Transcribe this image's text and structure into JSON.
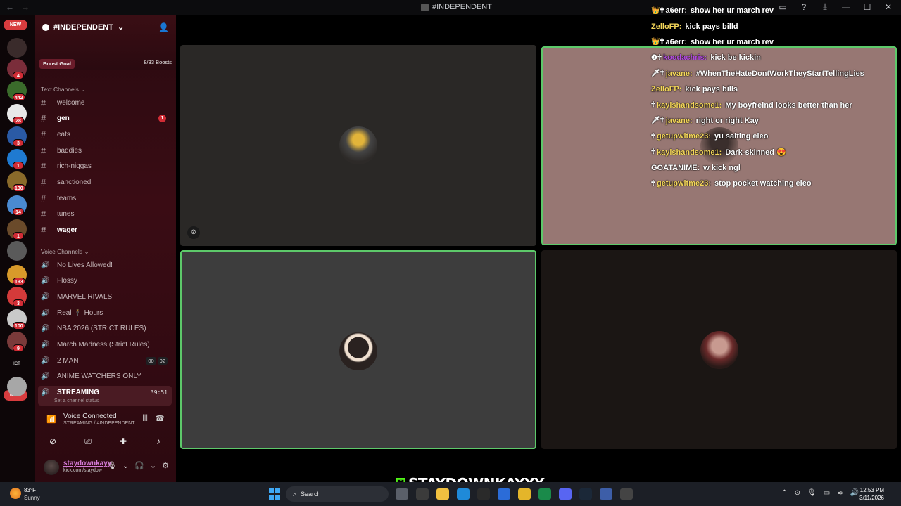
{
  "window": {
    "title": "#INDEPENDENT"
  },
  "guilds": {
    "new_top": "NEW",
    "new_bottom": "NEW",
    "badges": [
      "4",
      "442",
      "28",
      "3",
      "1",
      "130",
      "14",
      "1",
      "193",
      "3",
      "100",
      "9"
    ],
    "colors": [
      "#3a2b2b",
      "#7a2d3a",
      "#3a6b2b",
      "#e8e8e8",
      "#2a5aa5",
      "#1f7ad1",
      "#8a6a2a",
      "#4a8ad1",
      "#6a4a2a",
      "#5a5a5a",
      "#d89a2a",
      "#d43a3a",
      "#c9c9c9",
      "#7a3a3a",
      "#1a1a1a",
      "#a7a7a7"
    ],
    "ict_label": "ICT"
  },
  "server": {
    "name": "#INDEPENDENT",
    "boost_goal": "Boost Goal",
    "boost_count": "8/33 Boosts"
  },
  "text_channels": {
    "header": "Text Channels",
    "items": [
      {
        "name": "welcome"
      },
      {
        "name": "gen",
        "unread": "1"
      },
      {
        "name": "eats"
      },
      {
        "name": "baddies"
      },
      {
        "name": "rich-niggas"
      },
      {
        "name": "sanctioned"
      },
      {
        "name": "teams"
      },
      {
        "name": "tunes"
      },
      {
        "name": "wager"
      }
    ]
  },
  "voice_channels": {
    "header": "Voice Channels",
    "items": [
      {
        "name": "No Lives Allowed!"
      },
      {
        "name": "Flossy"
      },
      {
        "name": "MARVEL RIVALS"
      },
      {
        "name": "Real 🕴 Hours"
      },
      {
        "name": "NBA 2026 (STRICT RULES)"
      },
      {
        "name": "March Madness (Strict Rules)"
      },
      {
        "name": "2 MAN",
        "tag_a": "00",
        "tag_b": "02"
      },
      {
        "name": "ANIME WATCHERS ONLY"
      },
      {
        "name": "STREAMING",
        "timer": "39:51",
        "status": "Set a channel status"
      }
    ]
  },
  "voice": {
    "title": "Voice Connected",
    "subtitle": "STREAMING / #INDEPENDENT"
  },
  "user": {
    "name": "staydownkayy",
    "status": "kick.com/staydow"
  },
  "chat": [
    {
      "badge": "👑🕆",
      "user": "a6err:",
      "color": "#ffffff",
      "text": "show her ur march rev"
    },
    {
      "badge": "",
      "user": "ZelloFP:",
      "color": "#f5d75a",
      "text": "kick pays billd"
    },
    {
      "badge": "👑🕆",
      "user": "a6err:",
      "color": "#ffffff",
      "text": "show her ur march rev"
    },
    {
      "badge": "❶🕆",
      "user": "koodachris:",
      "color": "#b24be0",
      "text": "kick be kickin"
    },
    {
      "badge": "🗡🕆",
      "user": "javane:",
      "color": "#f5d75a",
      "text": "#WhenTheHateDontWorkTheyStartTellingLies"
    },
    {
      "badge": "",
      "user": "ZelloFP:",
      "color": "#f5d75a",
      "text": "kick pays bills"
    },
    {
      "badge": "🕆",
      "user": "kayishandsome1:",
      "color": "#f5d75a",
      "text": "My boyfreind looks better than her"
    },
    {
      "badge": "🗡🕆",
      "user": "javane:",
      "color": "#f5d75a",
      "text": "right or right Kay"
    },
    {
      "badge": "🕆",
      "user": "getupwitme23:",
      "color": "#f5d75a",
      "text": "yu salting eleo"
    },
    {
      "badge": "🕆",
      "user": "kayishandsome1:",
      "color": "#f5d75a",
      "text": "Dark-skinned 😍"
    },
    {
      "badge": "",
      "user": "GOATANIME:",
      "color": "#ffffff",
      "text": "w kick ngl"
    },
    {
      "badge": "🕆",
      "user": "getupwitme23:",
      "color": "#f5d75a",
      "text": "stop pocket watching eleo"
    }
  ],
  "overlay": {
    "streamer": "STAYDOWNKAYYY",
    "k_logo": "K"
  },
  "taskbar": {
    "temp": "83°F",
    "condition": "Sunny",
    "search": "Search",
    "time": "12:53 PM",
    "date": "3/11/2026"
  },
  "colors": {
    "speaking_border": "#5dc96a",
    "accent_red": "#d12c35",
    "kick_green": "#53fc18"
  }
}
